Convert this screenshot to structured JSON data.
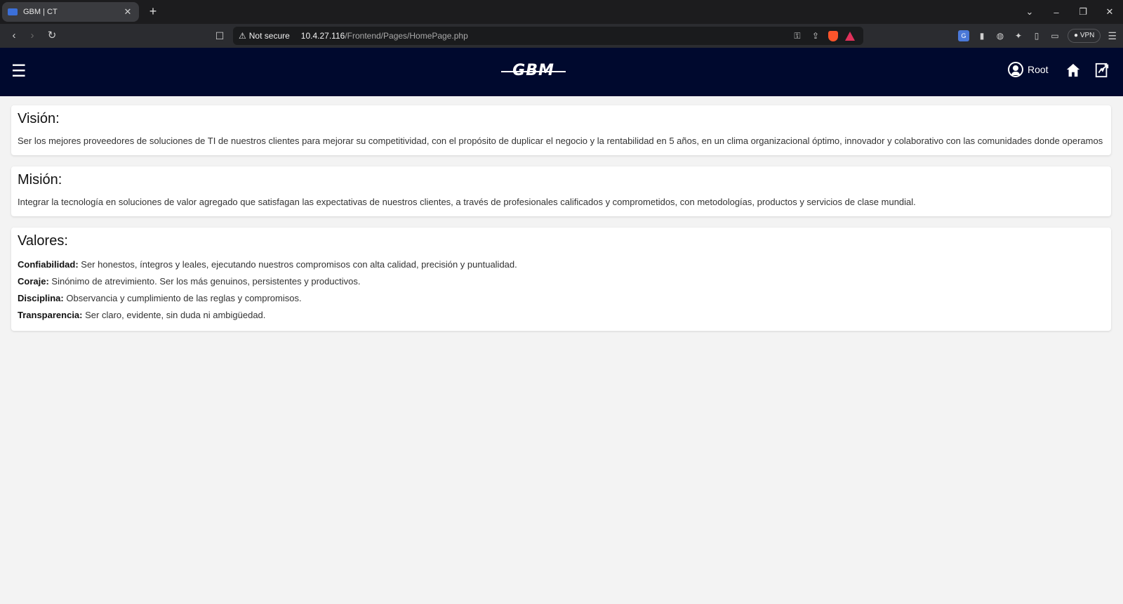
{
  "browser": {
    "tab_title": "GBM | CT",
    "tab_close": "✕",
    "new_tab": "+",
    "security_label": "Not secure",
    "url_host": "10.4.27.116",
    "url_path": "/Frontend/Pages/HomePage.php",
    "vpn_label": "● VPN"
  },
  "header": {
    "logo_text": "GBM",
    "user_name": "Root"
  },
  "vision": {
    "title": "Visión:",
    "text": "Ser los mejores proveedores de soluciones de TI de nuestros clientes para mejorar su competitividad, con el propósito de duplicar el negocio y la rentabilidad en 5 años, en un clima organizacional óptimo, innovador y colaborativo con las comunidades donde operamos"
  },
  "mision": {
    "title": "Misión:",
    "text": "Integrar la tecnología en soluciones de valor agregado que satisfagan las expectativas de nuestros clientes, a través de profesionales calificados y comprometidos, con metodologías, productos y servicios de clase mundial."
  },
  "valores": {
    "title": "Valores:",
    "items": [
      {
        "label": "Confiabilidad:",
        "text": " Ser honestos, íntegros y leales, ejecutando nuestros compromisos con alta calidad, precisión y puntualidad."
      },
      {
        "label": "Coraje:",
        "text": " Sinónimo de atrevimiento. Ser los más genuinos, persistentes y productivos."
      },
      {
        "label": "Disciplina:",
        "text": " Observancia y cumplimiento de las reglas y compromisos."
      },
      {
        "label": "Transparencia:",
        "text": " Ser claro, evidente, sin duda ni ambigüedad."
      }
    ]
  },
  "colors": {
    "header_bg": "#00092e",
    "page_bg": "#f3f3f3",
    "card_bg": "#ffffff"
  }
}
